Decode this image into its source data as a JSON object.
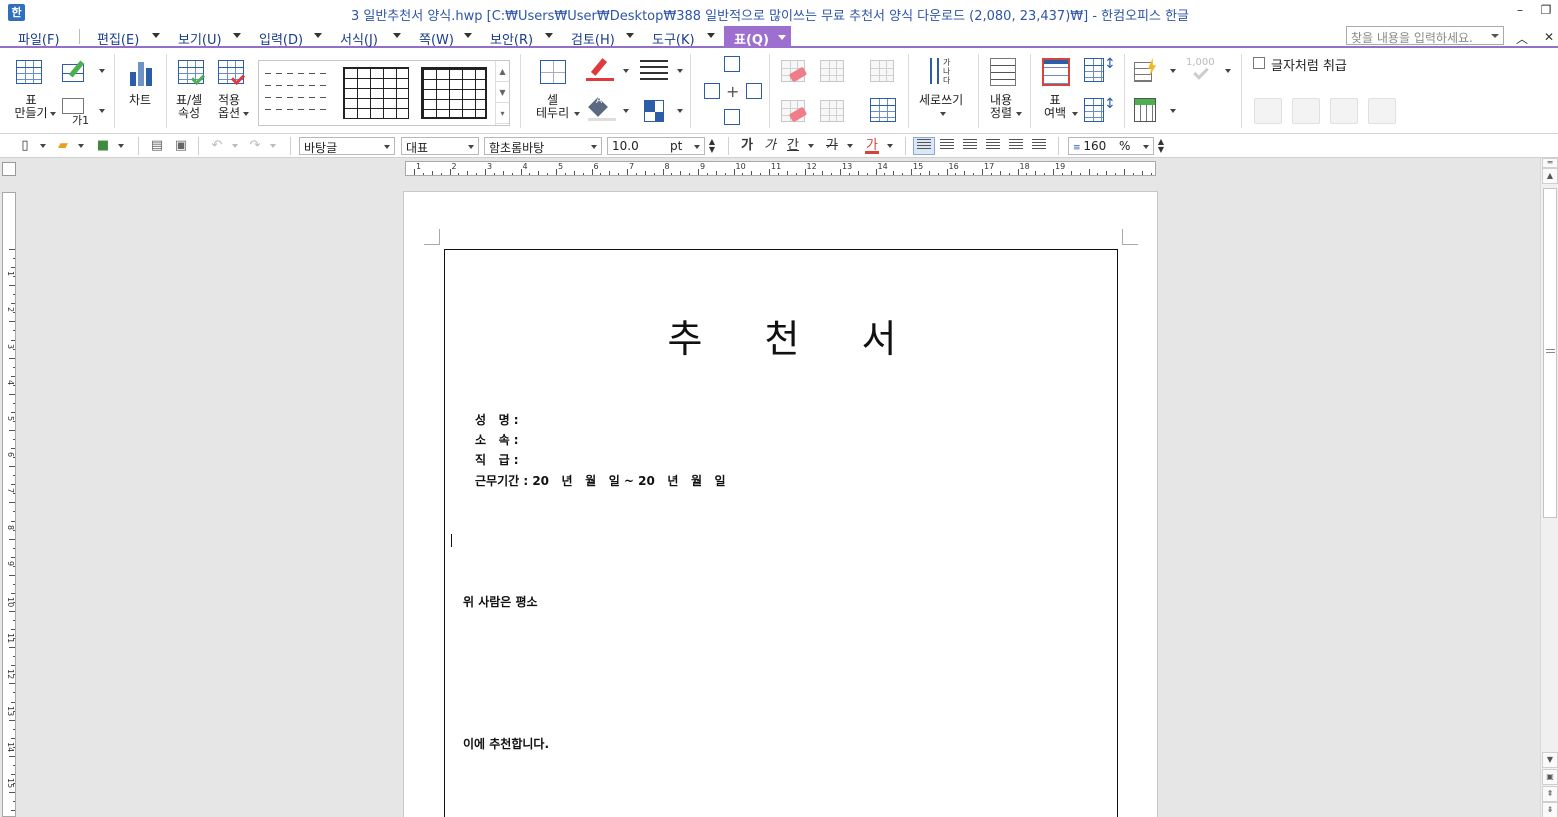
{
  "window": {
    "app_icon": "hwp-app-icon",
    "title": "3 일반추천서 양식.hwp [C:₩Users₩User₩Desktop₩388 일반적으로 많이쓰는 무료 추천서 양식 다운로드 (2,080, 23,437)₩] - 한컴오피스 한글",
    "minimize": "–",
    "restore": "❐"
  },
  "menu": {
    "items": [
      "파일(F)",
      "편집(E)",
      "보기(U)",
      "입력(D)",
      "서식(J)",
      "쪽(W)",
      "보안(R)",
      "검토(H)",
      "도구(K)"
    ],
    "active": "표(Q)",
    "search_placeholder": "찾을 내용을 입력하세요.",
    "collapse": "︿",
    "close": "✕"
  },
  "ribbon": {
    "make_table": "표\n만들기",
    "caption": "가1",
    "chart": "차트",
    "cell_props": "표/셀\n속성",
    "apply_options": "적용\n옵션",
    "cell_border": "셀\n테두리",
    "fill_label": "A",
    "vertical_writing": "세로쓰기",
    "vertical_glyph": "가\n나\n다",
    "content_align": "내용\n정렬",
    "table_margin": "표\n여백",
    "calc_hint": "1,000",
    "treat_as_char": "글자처럼 취급"
  },
  "format_bar": {
    "style": "바탕글",
    "lang": "대표",
    "font": "함초롬바탕",
    "size": "10.0",
    "size_unit": "pt",
    "bold": "가",
    "italic": "가",
    "underline": "간",
    "strike": "가",
    "color": "가",
    "line_spacing": "160",
    "line_spacing_unit": "%"
  },
  "ruler": {
    "h_numbers": [
      "1",
      "2",
      "3",
      "4",
      "5",
      "6",
      "7",
      "8",
      "9",
      "10",
      "11",
      "12",
      "13",
      "14",
      "15",
      "16",
      "17",
      "18",
      "19"
    ],
    "v_numbers": [
      "1",
      "2",
      "3",
      "4",
      "5",
      "6",
      "7",
      "8",
      "9",
      "10",
      "11",
      "12",
      "13",
      "14",
      "15"
    ]
  },
  "document": {
    "title": "추천서",
    "name_label": "성   명 :",
    "affiliation_label": "소   속 :",
    "rank_label": "직   급 :",
    "period_label": "근무기간 : 20   년   월   일 ~ 20   년   월   일",
    "para1": "위 사람은 평소",
    "para2": "이에 추천합니다."
  },
  "colors": {
    "accent": "#9d6fcf",
    "menu_text": "#1a3d86",
    "title_text": "#2e55a8"
  }
}
